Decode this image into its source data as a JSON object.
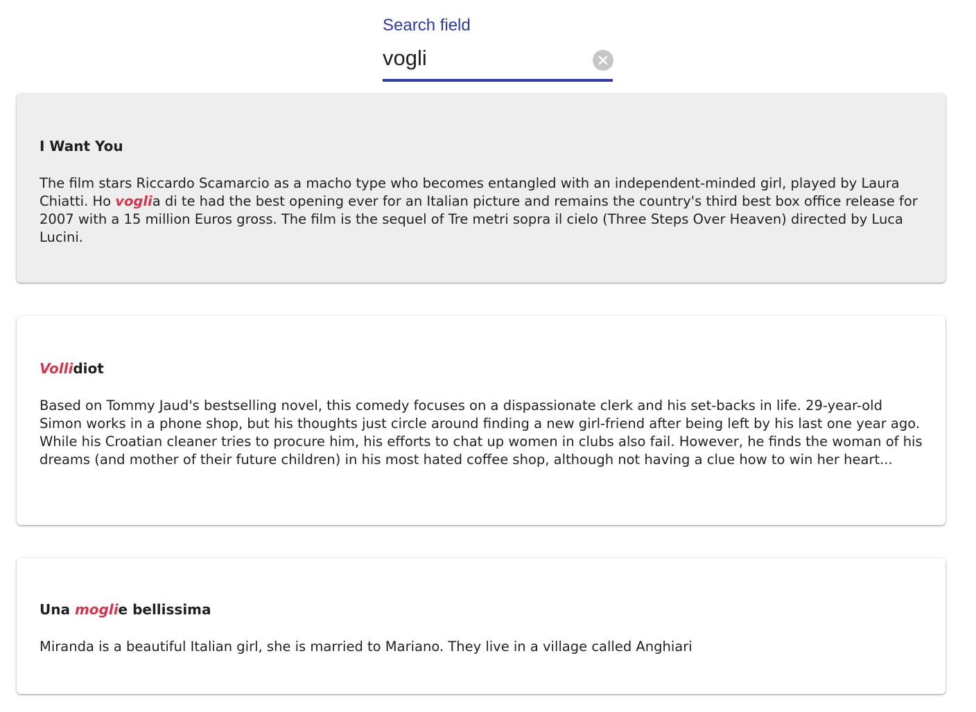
{
  "search": {
    "label": "Search field",
    "value": "vogli",
    "accent_color": "#2f3a9e",
    "clear_icon": "clear-circle-icon"
  },
  "highlight_color": "#d0374f",
  "results": [
    {
      "title_parts": [
        {
          "text": "I Want You",
          "highlight": false
        }
      ],
      "description_parts": [
        {
          "text": "The film stars Riccardo Scamarcio as a macho type who becomes entangled with an independent-minded girl, played by Laura Chiatti. Ho ",
          "highlight": false
        },
        {
          "text": "vogli",
          "highlight": true
        },
        {
          "text": "a di te had the best opening ever for an Italian picture and remains the country's third best box office release for 2007 with a 15 million Euros gross. The film is the sequel of Tre metri sopra il cielo (Three Steps Over Heaven) directed by Luca Lucini.",
          "highlight": false
        }
      ],
      "active": true
    },
    {
      "title_parts": [
        {
          "text": "Volli",
          "highlight": true
        },
        {
          "text": "diot",
          "highlight": false
        }
      ],
      "description_parts": [
        {
          "text": "Based on Tommy Jaud's bestselling novel, this comedy focuses on a dispassionate clerk and his set-backs in life. 29-year-old Simon works in a phone shop, but his thoughts just circle around finding a new girl-friend after being left by his last one year ago. While his Croatian cleaner tries to procure him, his efforts to chat up women in clubs also fail. However, he finds the woman of his dreams (and mother of their future children) in his most hated coffee shop, although not having a clue how to win her heart...",
          "highlight": false
        }
      ],
      "active": false
    },
    {
      "title_parts": [
        {
          "text": "Una ",
          "highlight": false
        },
        {
          "text": "mogli",
          "highlight": true
        },
        {
          "text": "e bellissima",
          "highlight": false
        }
      ],
      "description_parts": [
        {
          "text": "Miranda is a beautiful Italian girl, she is married to Mariano. They live in a village called Anghiari",
          "highlight": false
        }
      ],
      "active": false
    }
  ]
}
